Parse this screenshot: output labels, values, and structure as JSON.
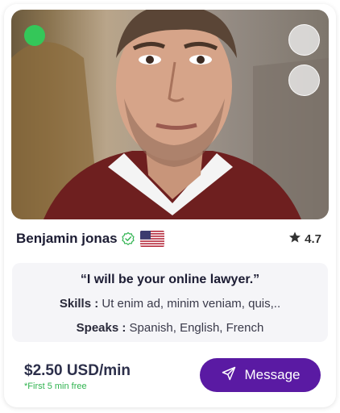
{
  "profile": {
    "name": "Benjamin jonas",
    "online": true,
    "rating": "4.7",
    "tagline": "“I will be your online lawyer.”",
    "skills_label": "Skills :",
    "skills_value": "Ut enim ad, minim veniam, quis,..",
    "speaks_label": "Speaks :",
    "speaks_value": "Spanish, English, French"
  },
  "pricing": {
    "price": "$2.50 USD/min",
    "note": "*First 5 min free"
  },
  "actions": {
    "message_label": "Message"
  },
  "colors": {
    "accent": "#5a1aa3",
    "online": "#34c759",
    "free_note": "#2fb34f"
  },
  "icons": [
    "heart-icon",
    "share-icon",
    "verified-icon",
    "us-flag-icon",
    "star-icon",
    "send-icon"
  ]
}
